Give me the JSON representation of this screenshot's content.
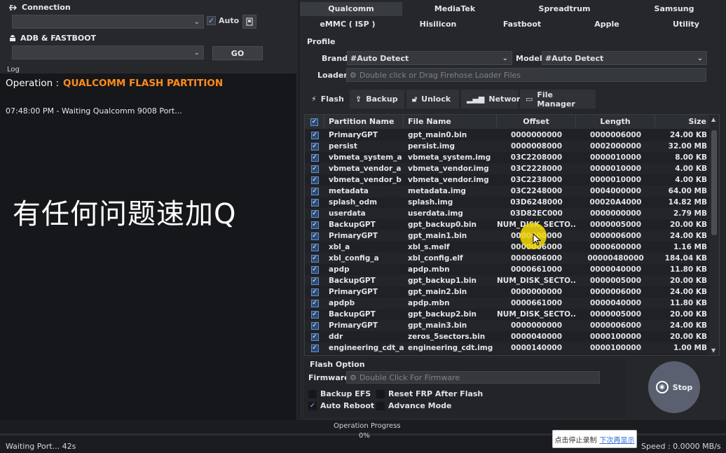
{
  "connection": {
    "title": "Connection",
    "auto_label": "Auto"
  },
  "adb": {
    "title": "ADB & FASTBOOT",
    "go_label": "GO"
  },
  "log": {
    "label": "Log",
    "operation_prefix": "Operation :",
    "operation_value": "QUALCOMM FLASH PARTITION",
    "line1": "07:48:00 PM - Waiting Qualcomm 9008 Port...",
    "overlay_text": "有任何问题速加Q"
  },
  "vendor_tabs": {
    "row1": [
      "Qualcomm",
      "MediaTek",
      "Spreadtrum",
      "Samsung"
    ],
    "row2": [
      "eMMC ( ISP )",
      "Hisilicon",
      "Fastboot",
      "Apple",
      "Utility"
    ]
  },
  "profile": {
    "title": "Profile",
    "brand_label": "Brand",
    "brand_value": "#Auto Detect",
    "model_label": "Model",
    "model_value": "#Auto Detect",
    "loader_label": "Loader",
    "loader_placeholder": "Double click or Drag Firehose Loader Files"
  },
  "subtabs": [
    "Flash",
    "Backup",
    "Unlock",
    "Network",
    "File Manager"
  ],
  "table": {
    "headers": [
      "Partition Name",
      "File Name",
      "Offset",
      "Length",
      "Size"
    ],
    "rows": [
      [
        "PrimaryGPT",
        "gpt_main0.bin",
        "0000000000",
        "0000006000",
        "24.00 KB"
      ],
      [
        "persist",
        "persist.img",
        "0000008000",
        "0002000000",
        "32.00 MB"
      ],
      [
        "vbmeta_system_a",
        "vbmeta_system.img",
        "03C2208000",
        "0000010000",
        "8.00 KB"
      ],
      [
        "vbmeta_vendor_a",
        "vbmeta_vendor.img",
        "03C2228000",
        "0000010000",
        "4.00 KB"
      ],
      [
        "vbmeta_vendor_b",
        "vbmeta_vendor.img",
        "03C2238000",
        "0000010000",
        "4.00 KB"
      ],
      [
        "metadata",
        "metadata.img",
        "03C2248000",
        "0004000000",
        "64.00 MB"
      ],
      [
        "splash_odm",
        "splash.img",
        "03D6248000",
        "00020A4000",
        "14.82 MB"
      ],
      [
        "userdata",
        "userdata.img",
        "03D82EC000",
        "0000000000",
        "2.79 MB"
      ],
      [
        "BackupGPT",
        "gpt_backup0.bin",
        "NUM_DISK_SECTO...",
        "0000005000",
        "20.00 KB"
      ],
      [
        "PrimaryGPT",
        "gpt_main1.bin",
        "0000000000",
        "0000006000",
        "24.00 KB"
      ],
      [
        "xbl_a",
        "xbl_s.melf",
        "0000006000",
        "0000600000",
        "1.16 MB"
      ],
      [
        "xbl_config_a",
        "xbl_config.elf",
        "0000606000",
        "00000480000",
        "184.04 KB"
      ],
      [
        "apdp",
        "apdp.mbn",
        "0000661000",
        "0000040000",
        "11.80 KB"
      ],
      [
        "BackupGPT",
        "gpt_backup1.bin",
        "NUM_DISK_SECTO...",
        "0000005000",
        "20.00 KB"
      ],
      [
        "PrimaryGPT",
        "gpt_main2.bin",
        "0000000000",
        "0000006000",
        "24.00 KB"
      ],
      [
        "apdpb",
        "apdp.mbn",
        "0000661000",
        "0000040000",
        "11.80 KB"
      ],
      [
        "BackupGPT",
        "gpt_backup2.bin",
        "NUM_DISK_SECTO...",
        "0000005000",
        "20.00 KB"
      ],
      [
        "PrimaryGPT",
        "gpt_main3.bin",
        "0000000000",
        "0000006000",
        "24.00 KB"
      ],
      [
        "ddr",
        "zeros_5sectors.bin",
        "0000040000",
        "0000100000",
        "20.00 KB"
      ],
      [
        "engineering_cdt_a",
        "engineering_cdt.img",
        "0000140000",
        "0000100000",
        "1.00 MB"
      ]
    ]
  },
  "flash_option": {
    "title": "Flash Option",
    "firmware_label": "Firmware",
    "firmware_placeholder": "Double Click For Firmware",
    "backup_efs": "Backup EFS",
    "reset_frp": "Reset FRP After Flash",
    "auto_reboot": "Auto Reboot",
    "advance_mode": "Advance Mode",
    "stop_label": "Stop"
  },
  "status": {
    "waiting": "Waiting Port... 42s",
    "progress_label": "Operation Progress",
    "progress_value": "0%",
    "progress_fraction": 0,
    "speed": "Speed : 0.0000 MB/s",
    "tooltip_text": "点击停止录制",
    "tooltip_link": "下次再显示"
  },
  "colors": {
    "accent_orange": "#ff8c1a",
    "highlight_yellow": "#f5d90a"
  }
}
